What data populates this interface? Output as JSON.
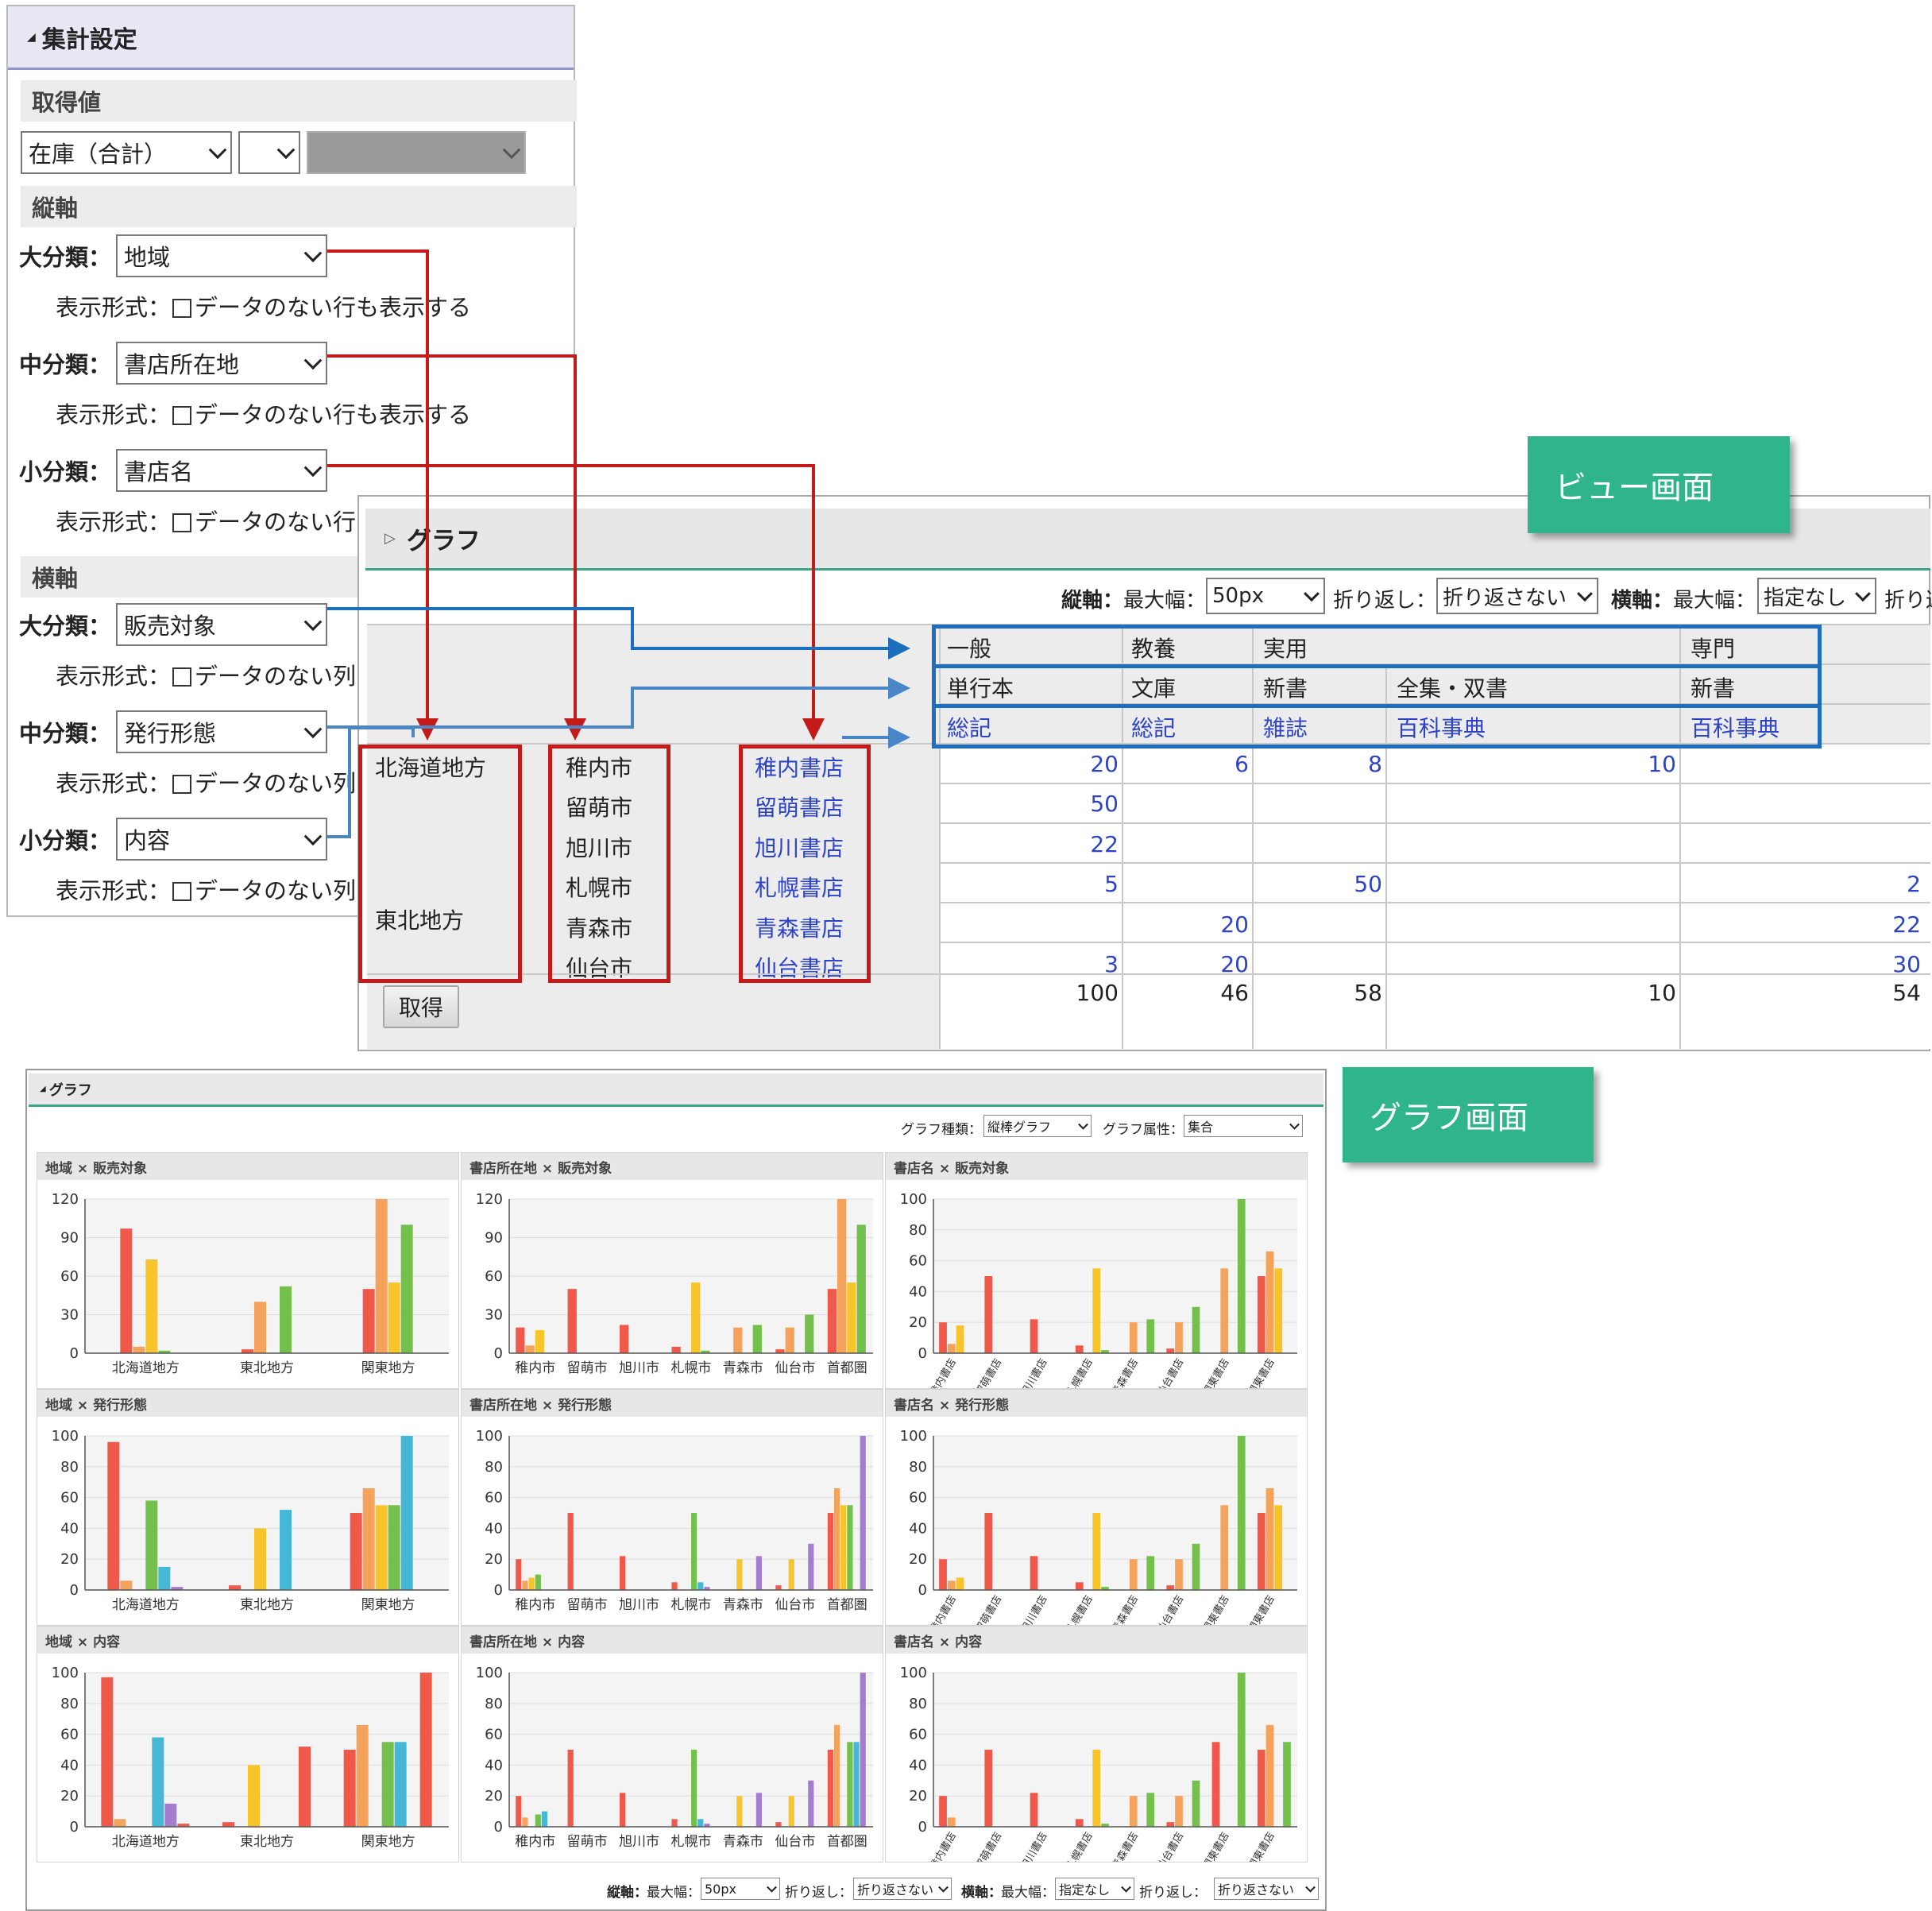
{
  "settings": {
    "title": "集計設定",
    "section_value": "取得値",
    "value_select": "在庫（合計）",
    "value_select2": "",
    "value_select3": "",
    "section_vertical": "縦軸",
    "section_horizontal": "横軸",
    "display_label": "表示形式：",
    "checkbox_text": "データのない行も表示する",
    "checkbox_text_short": "データのない行",
    "checkbox_text_short2": "データのない列",
    "vertical": [
      {
        "label": "大分類：",
        "value": "地域"
      },
      {
        "label": "中分類：",
        "value": "書店所在地"
      },
      {
        "label": "小分類：",
        "value": "書店名"
      }
    ],
    "horizontal": [
      {
        "label": "大分類：",
        "value": "販売対象"
      },
      {
        "label": "中分類：",
        "value": "発行形態"
      },
      {
        "label": "小分類：",
        "value": "内容"
      }
    ]
  },
  "badges": {
    "view": "ビュー画面",
    "graph": "グラフ画面"
  },
  "view": {
    "title": "グラフ",
    "toolbar": {
      "v_axis": "縦軸：",
      "max_width": "最大幅：",
      "max_width_value": "50px",
      "wrap": "折り返し：",
      "wrap_value": "折り返さない",
      "h_axis": "横軸：",
      "h_max_width": "最大幅：",
      "h_max_width_value": "指定なし",
      "h_wrap": "折り返"
    },
    "col_level1": [
      "一般",
      "教養",
      "実用",
      "専門"
    ],
    "col_level2": [
      "単行本",
      "文庫",
      "新書",
      "全集・双書",
      "新書"
    ],
    "col_level3": [
      "総記",
      "総記",
      "雑誌",
      "百科事典",
      "百科事典"
    ],
    "regions": [
      "北海道地方",
      "東北地方"
    ],
    "cities": [
      "稚内市",
      "留萌市",
      "旭川市",
      "札幌市",
      "青森市",
      "仙台市"
    ],
    "stores": [
      "稚内書店",
      "留萌書店",
      "旭川書店",
      "札幌書店",
      "青森書店",
      "仙台書店"
    ],
    "rows": [
      [
        "20",
        "6",
        "8",
        "10",
        ""
      ],
      [
        "50",
        "",
        "",
        "",
        ""
      ],
      [
        "22",
        "",
        "",
        "",
        ""
      ],
      [
        "5",
        "",
        "50",
        "",
        "2"
      ],
      [
        "",
        "20",
        "",
        "",
        "22"
      ],
      [
        "3",
        "20",
        "",
        "",
        "30"
      ]
    ],
    "totals": [
      "100",
      "46",
      "58",
      "10",
      "54"
    ],
    "fetch_button": "取得"
  },
  "graph": {
    "title": "グラフ",
    "type_label": "グラフ種類：",
    "type_value": "縦棒グラフ",
    "attr_label": "グラフ属性：",
    "attr_value": "集合",
    "footer": {
      "v_axis": "縦軸：",
      "max_width": "最大幅：",
      "max_width_value": "50px",
      "wrap": "折り返し：",
      "wrap_value": "折り返さない",
      "h_axis": "横軸：",
      "h_max_width": "最大幅：",
      "h_max_width_value": "指定なし",
      "h_wrap": "折り返し：",
      "h_wrap_value": "折り返さない"
    },
    "colors": [
      "#f0584a",
      "#f5a25c",
      "#f7c52b",
      "#73c04d",
      "#45b8d8",
      "#a47dd0"
    ]
  },
  "chart_data": [
    {
      "type": "bar",
      "title": "地域 × 販売対象",
      "categories": [
        "北海道地方",
        "東北地方",
        "関東地方"
      ],
      "ylim": [
        0,
        120
      ],
      "ticks": [
        0,
        30,
        60,
        90,
        120
      ],
      "series": [
        {
          "values": [
            97,
            3,
            50
          ]
        },
        {
          "values": [
            5,
            40,
            121
          ]
        },
        {
          "values": [
            73,
            0,
            55
          ]
        },
        {
          "values": [
            2,
            52,
            100
          ]
        }
      ]
    },
    {
      "type": "bar",
      "title": "書店所在地 × 販売対象",
      "categories": [
        "稚内市",
        "留萌市",
        "旭川市",
        "札幌市",
        "青森市",
        "仙台市",
        "首都圏"
      ],
      "ylim": [
        0,
        120
      ],
      "ticks": [
        0,
        30,
        60,
        90,
        120
      ],
      "series": [
        {
          "values": [
            20,
            50,
            22,
            5,
            0,
            3,
            50
          ]
        },
        {
          "values": [
            6,
            0,
            0,
            0,
            20,
            20,
            121
          ]
        },
        {
          "values": [
            18,
            0,
            0,
            55,
            0,
            0,
            55
          ]
        },
        {
          "values": [
            0,
            0,
            0,
            2,
            22,
            30,
            100
          ]
        }
      ]
    },
    {
      "type": "bar",
      "title": "書店名 × 販売対象",
      "categories": [
        "稚内書店",
        "留萌書店",
        "旭川書店",
        "札幌書店",
        "青森書店",
        "仙台書店",
        "北関東書店",
        "南関東書店"
      ],
      "ylim": [
        0,
        100
      ],
      "ticks": [
        0,
        20,
        40,
        60,
        80,
        100
      ],
      "series": [
        {
          "values": [
            20,
            50,
            22,
            5,
            0,
            3,
            0,
            50
          ]
        },
        {
          "values": [
            6,
            0,
            0,
            0,
            20,
            20,
            55,
            66
          ]
        },
        {
          "values": [
            18,
            0,
            0,
            55,
            0,
            0,
            0,
            55
          ]
        },
        {
          "values": [
            0,
            0,
            0,
            2,
            22,
            30,
            100,
            0
          ]
        }
      ]
    },
    {
      "type": "bar",
      "title": "地域 × 発行形態",
      "categories": [
        "北海道地方",
        "東北地方",
        "関東地方"
      ],
      "ylim": [
        0,
        100
      ],
      "ticks": [
        0,
        20,
        40,
        60,
        80,
        100
      ],
      "series": [
        {
          "values": [
            96,
            3,
            50
          ]
        },
        {
          "values": [
            6,
            0,
            66
          ]
        },
        {
          "values": [
            0,
            40,
            55
          ]
        },
        {
          "values": [
            58,
            0,
            55
          ]
        },
        {
          "values": [
            15,
            52,
            100
          ]
        },
        {
          "values": [
            2,
            0,
            0
          ]
        }
      ]
    },
    {
      "type": "bar",
      "title": "書店所在地 × 発行形態",
      "categories": [
        "稚内市",
        "留萌市",
        "旭川市",
        "札幌市",
        "青森市",
        "仙台市",
        "首都圏"
      ],
      "ylim": [
        0,
        100
      ],
      "ticks": [
        0,
        20,
        40,
        60,
        80,
        100
      ],
      "series": [
        {
          "values": [
            20,
            50,
            22,
            5,
            0,
            3,
            50
          ]
        },
        {
          "values": [
            6,
            0,
            0,
            0,
            0,
            0,
            66
          ]
        },
        {
          "values": [
            8,
            0,
            0,
            0,
            20,
            20,
            55
          ]
        },
        {
          "values": [
            10,
            0,
            0,
            50,
            0,
            0,
            55
          ]
        },
        {
          "values": [
            0,
            0,
            0,
            5,
            0,
            0,
            0
          ]
        },
        {
          "values": [
            0,
            0,
            0,
            2,
            22,
            30,
            100
          ]
        }
      ]
    },
    {
      "type": "bar",
      "title": "書店名 × 発行形態",
      "categories": [
        "稚内書店",
        "留萌書店",
        "旭川書店",
        "札幌書店",
        "青森書店",
        "仙台書店",
        "北関東書店",
        "南関東書店"
      ],
      "ylim": [
        0,
        100
      ],
      "ticks": [
        0,
        20,
        40,
        60,
        80,
        100
      ],
      "series": [
        {
          "values": [
            20,
            50,
            22,
            5,
            0,
            3,
            0,
            50
          ]
        },
        {
          "values": [
            6,
            0,
            0,
            0,
            20,
            20,
            55,
            66
          ]
        },
        {
          "values": [
            8,
            0,
            0,
            50,
            0,
            0,
            0,
            55
          ]
        },
        {
          "values": [
            0,
            0,
            0,
            2,
            22,
            30,
            100,
            0
          ]
        }
      ]
    },
    {
      "type": "bar",
      "title": "地域 × 内容",
      "categories": [
        "北海道地方",
        "東北地方",
        "関東地方"
      ],
      "ylim": [
        0,
        100
      ],
      "ticks": [
        0,
        20,
        40,
        60,
        80,
        100
      ],
      "series": [
        {
          "values": [
            97,
            3,
            50
          ]
        },
        {
          "values": [
            5,
            0,
            66
          ]
        },
        {
          "values": [
            0,
            40,
            0
          ]
        },
        {
          "values": [
            0,
            0,
            55
          ]
        },
        {
          "values": [
            58,
            0,
            55
          ]
        },
        {
          "values": [
            15,
            0,
            0
          ]
        },
        {
          "values": [
            2,
            52,
            100
          ]
        }
      ]
    },
    {
      "type": "bar",
      "title": "書店所在地 × 内容",
      "categories": [
        "稚内市",
        "留萌市",
        "旭川市",
        "札幌市",
        "青森市",
        "仙台市",
        "首都圏"
      ],
      "ylim": [
        0,
        100
      ],
      "ticks": [
        0,
        20,
        40,
        60,
        80,
        100
      ],
      "series": [
        {
          "values": [
            20,
            50,
            22,
            5,
            0,
            3,
            50
          ]
        },
        {
          "values": [
            6,
            0,
            0,
            0,
            0,
            0,
            66
          ]
        },
        {
          "values": [
            0,
            0,
            0,
            0,
            20,
            20,
            0
          ]
        },
        {
          "values": [
            8,
            0,
            0,
            50,
            0,
            0,
            55
          ]
        },
        {
          "values": [
            10,
            0,
            0,
            5,
            0,
            0,
            55
          ]
        },
        {
          "values": [
            0,
            0,
            0,
            2,
            22,
            30,
            100
          ]
        }
      ]
    },
    {
      "type": "bar",
      "title": "書店名 × 内容",
      "categories": [
        "稚内書店",
        "留萌書店",
        "旭川書店",
        "札幌書店",
        "青森書店",
        "仙台書店",
        "北関東書店",
        "南関東書店"
      ],
      "ylim": [
        0,
        100
      ],
      "ticks": [
        0,
        20,
        40,
        60,
        80,
        100
      ],
      "series": [
        {
          "values": [
            20,
            50,
            22,
            5,
            0,
            3,
            55,
            50
          ]
        },
        {
          "values": [
            6,
            0,
            0,
            0,
            20,
            20,
            0,
            66
          ]
        },
        {
          "values": [
            0,
            0,
            0,
            50,
            0,
            0,
            0,
            0
          ]
        },
        {
          "values": [
            0,
            0,
            0,
            2,
            22,
            30,
            100,
            55
          ]
        }
      ]
    }
  ]
}
